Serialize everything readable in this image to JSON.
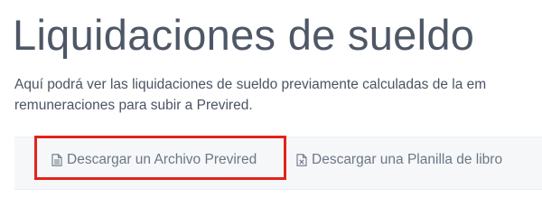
{
  "page": {
    "title": "Liquidaciones de sueldo",
    "description_line1": "Aquí podrá ver las liquidaciones de sueldo previamente calculadas de la em",
    "description_line2": "remuneraciones para subir a Previred."
  },
  "actions": [
    {
      "label": "Descargar un Archivo Previred",
      "icon": "file-text-icon"
    },
    {
      "label": "Descargar una Planilla de libro",
      "icon": "file-excel-icon"
    }
  ],
  "colors": {
    "title": "#4e5766",
    "text": "#4a5464",
    "button_text": "#6b7785",
    "bar_bg": "#f6f7f9",
    "highlight": "#e2231a"
  }
}
